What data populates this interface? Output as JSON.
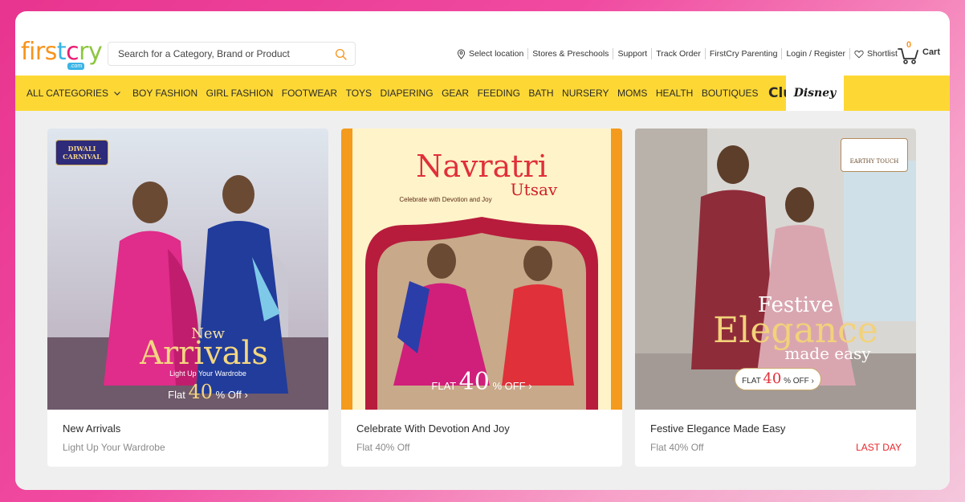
{
  "logo": {
    "text": "firstcry",
    "sub": ".com"
  },
  "search": {
    "placeholder": "Search for a Category, Brand or Product"
  },
  "top_links": {
    "location": "Select location",
    "stores": "Stores & Preschools",
    "support": "Support",
    "track": "Track Order",
    "parenting": "FirstCry Parenting",
    "login": "Login / Register",
    "shortlist": "Shortlist"
  },
  "cart": {
    "count": "0",
    "label": "Cart"
  },
  "nav": {
    "all_categories": "ALL CATEGORIES",
    "items": [
      "BOY FASHION",
      "GIRL FASHION",
      "FOOTWEAR",
      "TOYS",
      "DIAPERING",
      "GEAR",
      "FEEDING",
      "BATH",
      "NURSERY",
      "MOMS",
      "HEALTH",
      "BOUTIQUES"
    ],
    "club": "Club",
    "disney": "Disney"
  },
  "tiles": [
    {
      "title": "New Arrivals",
      "subtitle": "Light Up Your Wardrobe",
      "badge": "",
      "tag": "DIWALI CARNIVAL",
      "banner_line1": "New",
      "banner_line2": "Arrivals",
      "banner_line3": "Light Up Your Wardrobe",
      "banner_offer_pre": "Flat",
      "banner_offer_num": "40",
      "banner_offer_post": "% Off ›"
    },
    {
      "title": "Celebrate With Devotion And Joy",
      "subtitle": "Flat 40% Off",
      "badge": "",
      "banner_line1": "Navratri",
      "banner_line2": "Utsav",
      "banner_line3": "Celebrate with Devotion and Joy",
      "banner_offer_pre": "FLAT",
      "banner_offer_num": "40",
      "banner_offer_post": "% OFF ›"
    },
    {
      "title": "Festive Elegance Made Easy",
      "subtitle": "Flat 40% Off",
      "badge": "LAST DAY",
      "tag": "EARTHY TOUCH",
      "banner_line1": "Festive",
      "banner_line2": "Elegance",
      "banner_line3": "made easy",
      "banner_offer_pre": "FLAT",
      "banner_offer_num": "40",
      "banner_offer_post": "% OFF ›"
    }
  ],
  "colors": {
    "nav_bg": "#fdd835",
    "accent_orange": "#f7941d",
    "badge_red": "#e8262c"
  }
}
